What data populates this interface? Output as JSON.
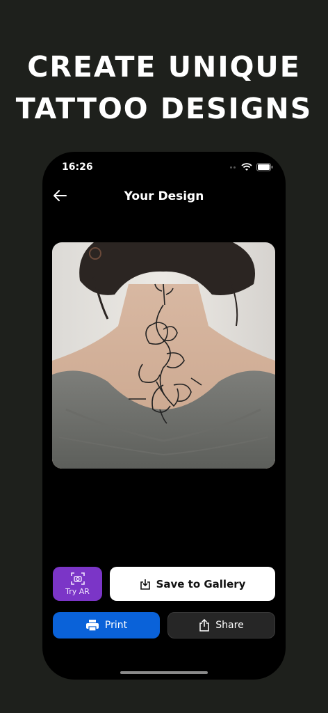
{
  "headline": {
    "line1": "CREATE UNIQUE",
    "line2": "TATTOO DESIGNS"
  },
  "status_bar": {
    "time": "16:26",
    "icons": [
      "cellular-icon",
      "wifi-icon",
      "battery-icon"
    ]
  },
  "nav": {
    "title": "Your Design",
    "back_icon": "arrow-left-icon"
  },
  "preview": {
    "image": "neck-flower-tattoo-photo"
  },
  "actions": {
    "try_ar": {
      "label": "Try AR",
      "icon": "camera-scan-icon",
      "color": "#7b35c7"
    },
    "save": {
      "label": "Save to Gallery",
      "icon": "download-icon"
    },
    "print": {
      "label": "Print",
      "icon": "printer-icon",
      "color": "#0a62d9"
    },
    "share": {
      "label": "Share",
      "icon": "share-icon"
    }
  },
  "colors": {
    "background": "#1e201c",
    "phone": "#000000"
  }
}
